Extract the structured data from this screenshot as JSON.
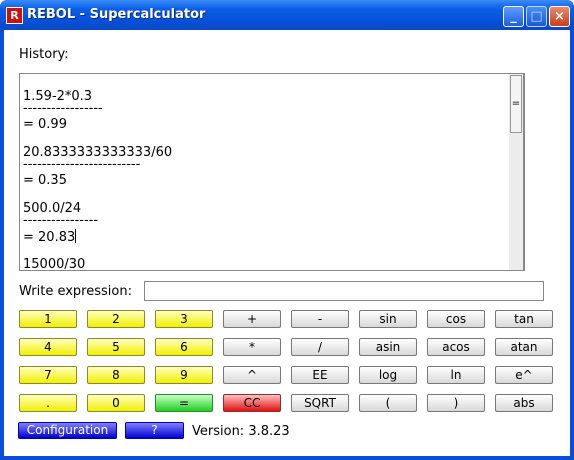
{
  "window": {
    "title": "REBOL - Supercalculator",
    "app_icon_letter": "R",
    "controls": {
      "minimize": "_",
      "maximize": "□",
      "close": "×"
    }
  },
  "history": {
    "label": "History:",
    "lines": [
      "1.59-2*0.3",
      "-----------------",
      "=  0.99",
      "20.8333333333333/60",
      "-------------------------",
      "=  0.35",
      "500.0/24",
      "----------------",
      "=  20.83",
      "15000/30"
    ],
    "scrollbar_thumb_glyph": "="
  },
  "expression": {
    "label": "Write expression:",
    "value": ""
  },
  "keypad": {
    "row1": [
      "1",
      "2",
      "3",
      "+",
      "-",
      "sin",
      "cos",
      "tan"
    ],
    "row2": [
      "4",
      "5",
      "6",
      "*",
      "/",
      "asin",
      "acos",
      "atan"
    ],
    "row3": [
      "7",
      "8",
      "9",
      "^",
      "EE",
      "log",
      "ln",
      "e^"
    ],
    "row4": [
      ".",
      "0",
      "=",
      "CC",
      "SQRT",
      "(",
      ")",
      "abs"
    ]
  },
  "footer": {
    "configuration": "Configuration",
    "help": "?",
    "version": "Version: 3.8.23"
  },
  "colors": {
    "titlebar": "#0750d8",
    "digit_button": "#f0f000",
    "equals_button": "#20d020",
    "clear_button": "#e01010",
    "footer_button": "#0000d0"
  }
}
